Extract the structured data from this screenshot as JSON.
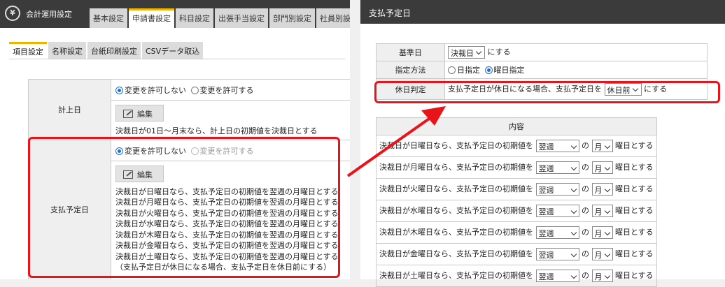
{
  "left_window": {
    "app_title": "会計運用設定",
    "logo_glyph": "¥",
    "main_tabs": [
      {
        "label": "基本設定",
        "active": false
      },
      {
        "label": "申請書設定",
        "active": true
      },
      {
        "label": "科目設定",
        "active": false
      },
      {
        "label": "出張手当設定",
        "active": false
      },
      {
        "label": "部門別設定",
        "active": false
      },
      {
        "label": "社員別設",
        "active": false
      }
    ],
    "sub_tabs": [
      {
        "label": "項目設定",
        "active": true
      },
      {
        "label": "名称設定",
        "active": false
      },
      {
        "label": "台紙印刷設定",
        "active": false
      },
      {
        "label": "CSVデータ取込",
        "active": false
      }
    ],
    "rows": {
      "posting_date": {
        "label": "計上日",
        "option_deny": "変更を許可しない",
        "option_allow": "変更を許可する",
        "edit_label": "編集",
        "description": "決裁日が01日～月末なら、計上日の初期値を決裁日とする"
      },
      "payment_date": {
        "label": "支払予定日",
        "option_deny": "変更を許可しない",
        "option_allow": "変更を許可する",
        "edit_label": "編集",
        "description_lines": [
          "決裁日が日曜日なら、支払予定日の初期値を翌週の月曜日とする",
          "決裁日が月曜日なら、支払予定日の初期値を翌週の月曜日とする",
          "決裁日が火曜日なら、支払予定日の初期値を翌週の月曜日とする",
          "決裁日が水曜日なら、支払予定日の初期値を翌週の月曜日とする",
          "決裁日が木曜日なら、支払予定日の初期値を翌週の月曜日とする",
          "決裁日が金曜日なら、支払予定日の初期値を翌週の月曜日とする",
          "決裁日が土曜日なら、支払予定日の初期値を翌週の月曜日とする",
          "（支払予定日が休日になる場合、支払予定日を休日前にする）"
        ]
      }
    }
  },
  "right_window": {
    "title": "支払予定日",
    "basis": {
      "label": "基準日",
      "select_value": "決裁日",
      "suffix": "にする"
    },
    "method": {
      "label": "指定方法",
      "option_day": "日指定",
      "option_weekday": "曜日指定"
    },
    "holiday": {
      "label": "休日判定",
      "prefix": "支払予定日が休日になる場合、支払予定日を",
      "select_value": "休日前",
      "suffix": "にする"
    },
    "content": {
      "header": "内容",
      "rows": [
        {
          "prefix": "決裁日が日曜日なら、支払予定日の初期値を",
          "week": "翌週",
          "mid": "の",
          "day": "月",
          "suffix": "曜日とする"
        },
        {
          "prefix": "決裁日が月曜日なら、支払予定日の初期値を",
          "week": "翌週",
          "mid": "の",
          "day": "月",
          "suffix": "曜日とする"
        },
        {
          "prefix": "決裁日が火曜日なら、支払予定日の初期値を",
          "week": "翌週",
          "mid": "の",
          "day": "月",
          "suffix": "曜日とする"
        },
        {
          "prefix": "決裁日が水曜日なら、支払予定日の初期値を",
          "week": "翌週",
          "mid": "の",
          "day": "月",
          "suffix": "曜日とする"
        },
        {
          "prefix": "決裁日が木曜日なら、支払予定日の初期値を",
          "week": "翌週",
          "mid": "の",
          "day": "月",
          "suffix": "曜日とする"
        },
        {
          "prefix": "決裁日が金曜日なら、支払予定日の初期値を",
          "week": "翌週",
          "mid": "の",
          "day": "月",
          "suffix": "曜日とする"
        },
        {
          "prefix": "決裁日が土曜日なら、支払予定日の初期値を",
          "week": "翌週",
          "mid": "の",
          "day": "月",
          "suffix": "曜日とする"
        }
      ]
    }
  },
  "colors": {
    "highlight": "#e8141a",
    "header_bg": "#3b3b3b",
    "active_tab_accent": "#f0b400"
  }
}
